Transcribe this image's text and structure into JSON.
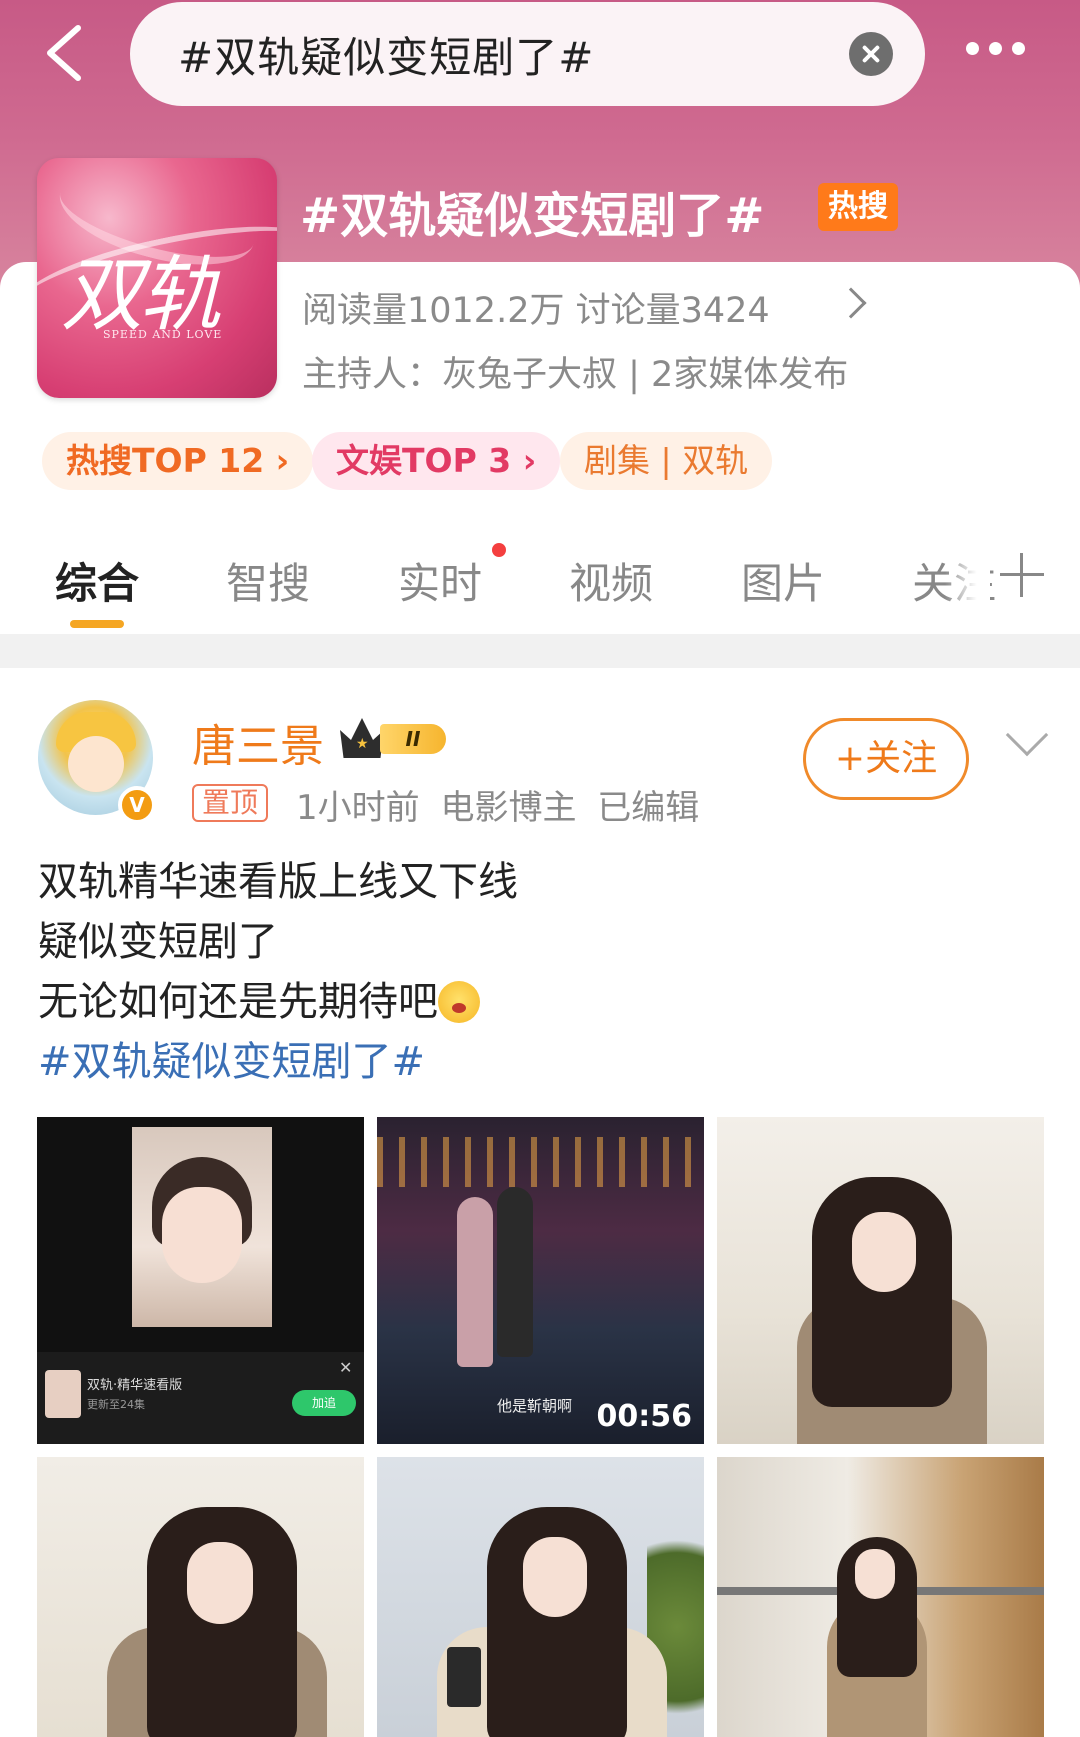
{
  "search": {
    "query": "#双轨疑似变短剧了#"
  },
  "topic": {
    "cover_title": "双轨",
    "cover_subtitle": "SPEED AND LOVE",
    "title": "#双轨疑似变短剧了#",
    "hot_badge": "热搜",
    "stats": "阅读量1012.2万  讨论量3424",
    "host": "主持人：灰兔子大叔 | 2家媒体发布",
    "chips": [
      "热搜TOP 12 ›",
      "文娱TOP 3 ›",
      "剧集 | 双轨"
    ]
  },
  "tabs": [
    "综合",
    "智搜",
    "实时",
    "视频",
    "图片",
    "关注"
  ],
  "active_tab": "综合",
  "post": {
    "author": "唐三景",
    "vip_level": "II",
    "pin_label": "置顶",
    "meta": "1小时前 电影博主 已编辑",
    "follow_label": "+关注",
    "lines": [
      "双轨精华速看版上线又下线",
      "疑似变短剧了",
      "无论如何还是先期待吧"
    ],
    "emoji": "cry-face-emoji",
    "hashtag": "#双轨疑似变短剧了#",
    "images": {
      "img1_title": "双轨·精华速看版",
      "img1_sub": "更新至24集",
      "img1_join": "加追",
      "img2_subtitle": "他是靳朝啊",
      "img2_duration": "00:56"
    }
  },
  "colors": {
    "accent_orange": "#ef7a1a",
    "hashtag_blue": "#3a6fb5",
    "hot_badge": "#ff7a1a"
  }
}
